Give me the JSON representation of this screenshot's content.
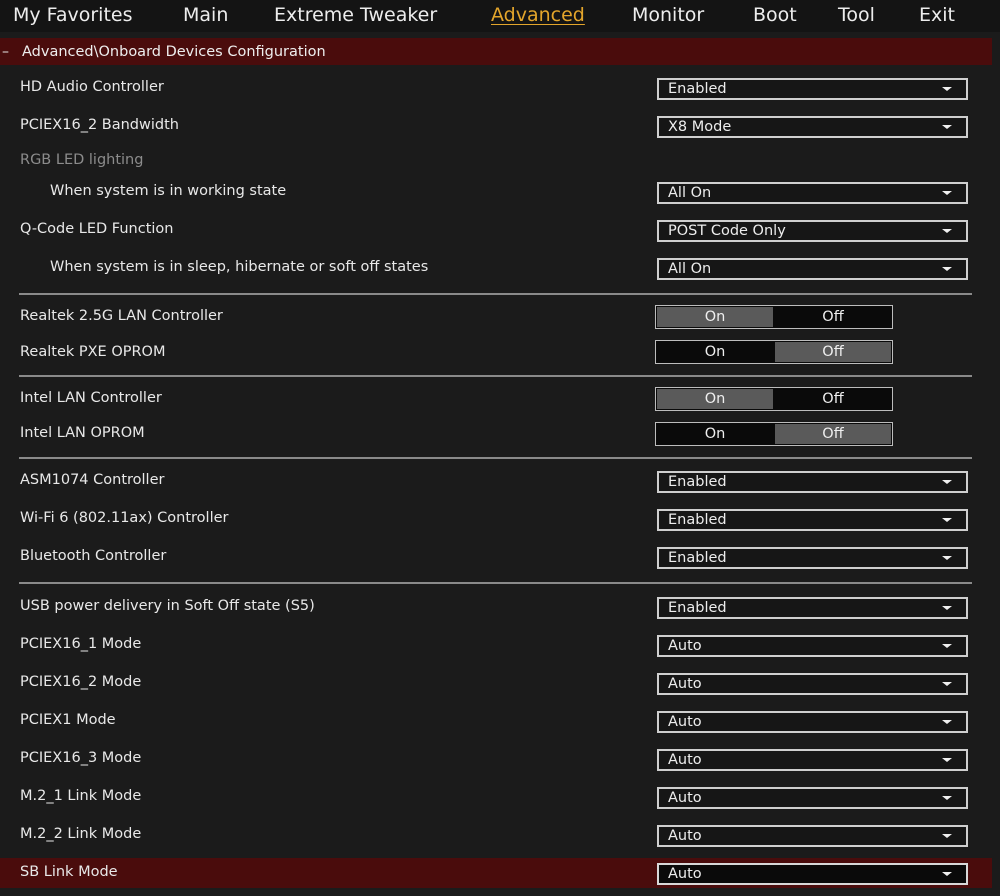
{
  "menu": {
    "tabs": [
      {
        "label": "My Favorites"
      },
      {
        "label": "Main"
      },
      {
        "label": "Extreme Tweaker"
      },
      {
        "label": "Advanced",
        "active": true
      },
      {
        "label": "Monitor"
      },
      {
        "label": "Boot"
      },
      {
        "label": "Tool"
      },
      {
        "label": "Exit"
      }
    ]
  },
  "header": {
    "collapse_symbol": "–",
    "breadcrumb": "Advanced\\Onboard Devices Configuration"
  },
  "settings": {
    "hd_audio": {
      "label": "HD Audio Controller",
      "value": "Enabled"
    },
    "pciex16_2_bw": {
      "label": "PCIEX16_2 Bandwidth",
      "value": "X8 Mode"
    },
    "rgb_header": {
      "label": "RGB LED lighting"
    },
    "rgb_working": {
      "label": "When system is in working state",
      "value": "All On"
    },
    "qcode": {
      "label": "Q-Code LED Function",
      "value": "POST Code Only"
    },
    "rgb_sleep": {
      "label": "When system is in sleep, hibernate or soft off states",
      "value": "All On"
    },
    "realtek_lan": {
      "label": "Realtek 2.5G LAN Controller",
      "on": "On",
      "off": "Off",
      "selected": "On"
    },
    "realtek_pxe": {
      "label": "Realtek PXE OPROM",
      "on": "On",
      "off": "Off",
      "selected": "Off"
    },
    "intel_lan": {
      "label": "Intel LAN Controller",
      "on": "On",
      "off": "Off",
      "selected": "On"
    },
    "intel_oprom": {
      "label": "Intel LAN OPROM",
      "on": "On",
      "off": "Off",
      "selected": "Off"
    },
    "asm1074": {
      "label": "ASM1074 Controller",
      "value": "Enabled"
    },
    "wifi": {
      "label": "Wi-Fi 6 (802.11ax) Controller",
      "value": "Enabled"
    },
    "bluetooth": {
      "label": "Bluetooth Controller",
      "value": "Enabled"
    },
    "usb_power": {
      "label": "USB power delivery in Soft Off state (S5)",
      "value": "Enabled"
    },
    "pciex16_1_mode": {
      "label": "PCIEX16_1 Mode",
      "value": "Auto"
    },
    "pciex16_2_mode": {
      "label": "PCIEX16_2 Mode",
      "value": "Auto"
    },
    "pciex1_mode": {
      "label": "PCIEX1 Mode",
      "value": "Auto"
    },
    "pciex16_3_mode": {
      "label": "PCIEX16_3 Mode",
      "value": "Auto"
    },
    "m2_1_link": {
      "label": "M.2_1 Link Mode",
      "value": "Auto"
    },
    "m2_2_link": {
      "label": "M.2_2 Link Mode",
      "value": "Auto"
    },
    "sb_link": {
      "label": "SB Link Mode",
      "value": "Auto"
    }
  },
  "colors": {
    "accent_active_tab": "#e3a52b",
    "highlight_bar": "#4a0c0c",
    "background": "#1b1b1b"
  }
}
